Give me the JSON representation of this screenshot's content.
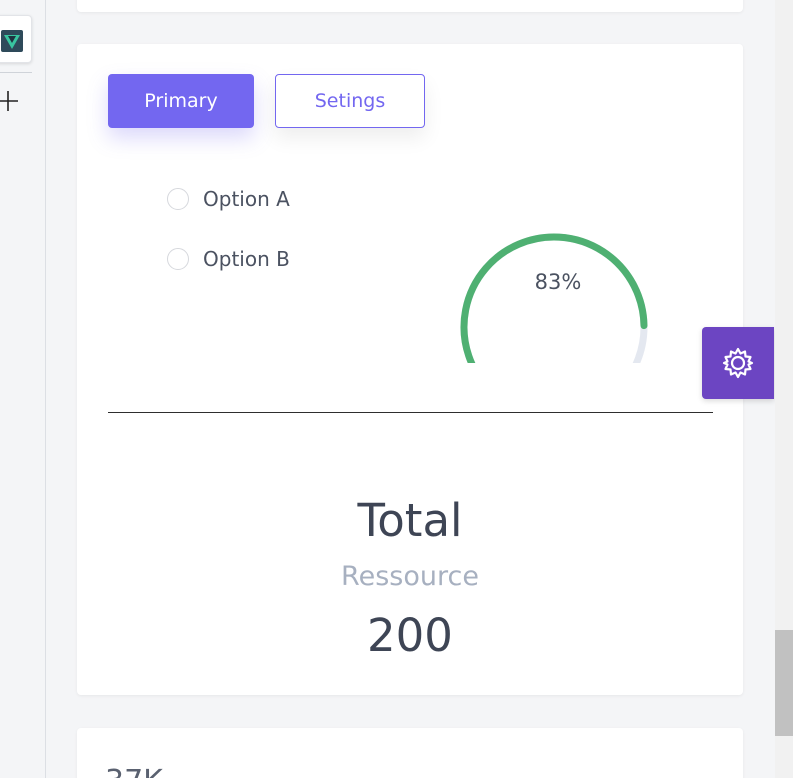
{
  "sidebar": {
    "app_icon": "app-logo-icon",
    "add_icon": "plus-icon"
  },
  "buttons": {
    "primary_label": "Primary",
    "settings_label": "Setings"
  },
  "options": [
    {
      "label": "Option A",
      "checked": false
    },
    {
      "label": "Option B",
      "checked": false
    }
  ],
  "gauge": {
    "value": 83,
    "label": "83%",
    "color": "#4fb072",
    "track_color": "#e4e8f0"
  },
  "total": {
    "title": "Total",
    "subtitle": "Ressource",
    "value": "200"
  },
  "next_card": {
    "peek_text": "37K"
  },
  "floating": {
    "settings_icon": "gear-icon",
    "color": "#6c45c2"
  },
  "colors": {
    "accent": "#7367f0"
  }
}
